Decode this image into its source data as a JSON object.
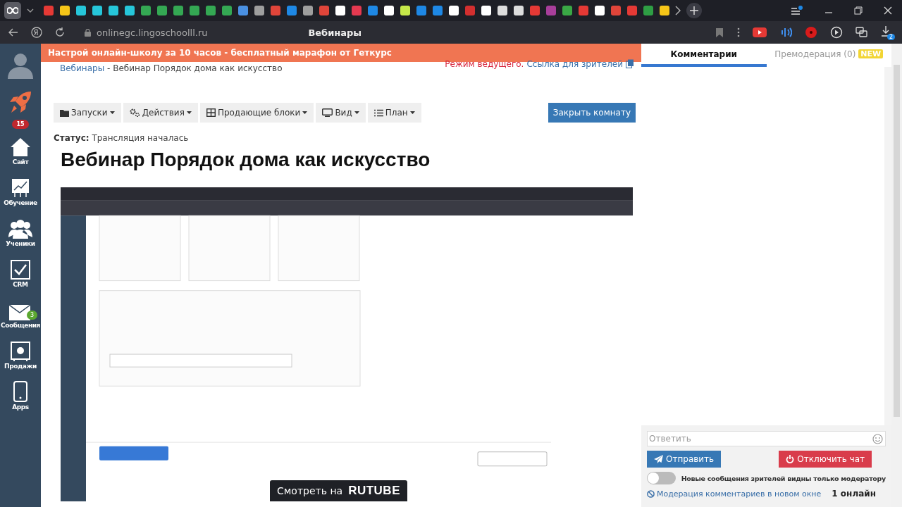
{
  "browser": {
    "url": "onlinegc.lingoschoolll.ru",
    "page_title": "Вебинары",
    "download_count": "2"
  },
  "sidebar": {
    "badge": "15",
    "items": [
      {
        "label": "Сайт",
        "kind": "home"
      },
      {
        "label": "Обучение",
        "kind": "chart"
      },
      {
        "label": "Ученики",
        "kind": "people"
      },
      {
        "label": "CRM",
        "kind": "check"
      },
      {
        "label": "Сообщения",
        "kind": "mail",
        "badge": "3"
      },
      {
        "label": "Продажи",
        "kind": "safe"
      },
      {
        "label": "Apps",
        "kind": "phone"
      }
    ]
  },
  "banner": "Настрой онлайн-школу за 10 часов - бесплатный марафон от Геткурс",
  "breadcrumb": {
    "link": "Вебинары",
    "current": "- Вебинар Порядок дома как искусство"
  },
  "host_mode": "Режим ведущего.",
  "viewer_link": "Ссылка для зрителей",
  "toolbar": [
    {
      "label": "Запуски",
      "kind": "folder"
    },
    {
      "label": "Действия",
      "kind": "gears"
    },
    {
      "label": "Продающие блоки",
      "kind": "grid"
    },
    {
      "label": "Вид",
      "kind": "monitor"
    },
    {
      "label": "План",
      "kind": "list"
    }
  ],
  "close_room": "Закрыть комнату",
  "status": {
    "label": "Статус:",
    "value": "Трансляция началась"
  },
  "title": "Вебинар Порядок дома как искусство",
  "player": {
    "kind": "picture",
    "watch_label": "Смотреть на",
    "brand": "RUTUBE"
  },
  "comments": {
    "tabs": [
      {
        "label": "Комментарии",
        "selected": true
      },
      {
        "label": "Премодерация (0)",
        "selected": false,
        "badge": "NEW"
      }
    ],
    "reply_placeholder": "Ответить",
    "send": "Отправить",
    "disable_chat": "Отключить чат",
    "premod_toggle": {
      "label": "Новые сообщения зрителей видны только модератору",
      "on": false
    },
    "moderation_link": "Модерация комментариев в новом окне",
    "online": "1 онлайн"
  }
}
